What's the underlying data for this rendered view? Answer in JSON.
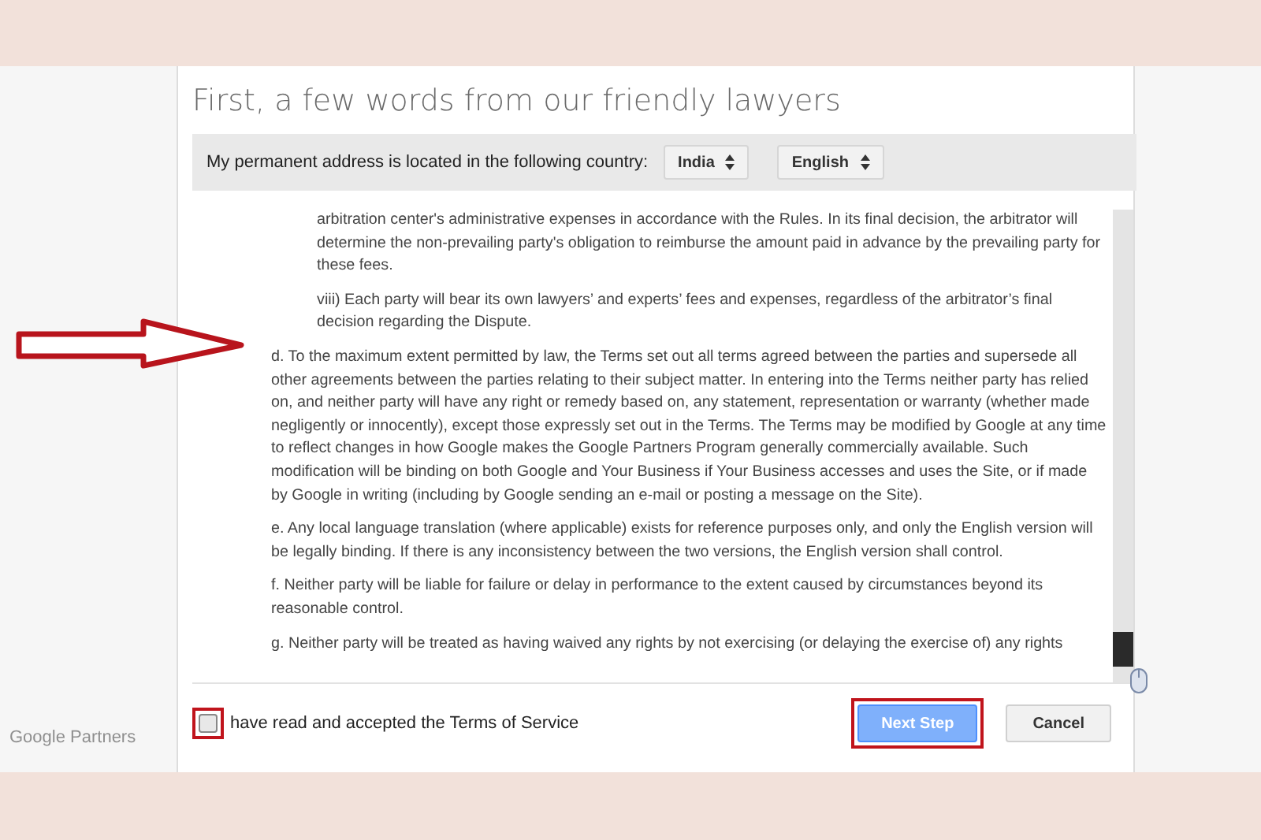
{
  "dialog": {
    "title": "First, a few words from our friendly lawyers",
    "country_bar": {
      "label": "My permanent address is located in the following country:",
      "country": "India",
      "language": "English"
    },
    "terms": [
      {
        "kind": "subitem",
        "text": "arbitration center's administrative expenses in accordance with the Rules. In its final decision, the arbitrator will determine the non-prevailing party's obligation to reimburse the amount paid in advance by the prevailing party for these fees."
      },
      {
        "kind": "subitem",
        "text": "viii) Each party will bear its own lawyers’ and experts’ fees and expenses, regardless of the arbitrator’s final decision regarding the Dispute."
      },
      {
        "kind": "item",
        "text": "d. To the maximum extent permitted by law, the Terms set out all terms agreed between the parties and supersede all other agreements between the parties relating to their subject matter. In entering into the Terms neither party has relied on, and neither party will have any right or remedy based on, any statement, representation or warranty (whether made negligently or innocently), except those expressly set out in the Terms. The Terms may be modified by Google at any time to reflect changes in how Google makes the Google Partners Program generally commercially available. Such modification will be binding on both Google and Your Business if Your Business accesses and uses the Site, or if made by Google in writing (including by Google sending an e-mail or posting a message on the Site)."
      },
      {
        "kind": "item",
        "text": "e. Any local language translation (where applicable) exists for reference purposes only, and only the English version will be legally binding. If there is any inconsistency between the two versions, the English version shall control."
      },
      {
        "kind": "item",
        "text": "f. Neither party will be liable for failure or delay in performance to the extent caused by circumstances beyond its reasonable control."
      },
      {
        "kind": "item",
        "text": "g. Neither party will be treated as having waived any rights by not exercising (or delaying the exercise of) any rights"
      }
    ],
    "accept": {
      "label": "have read and accepted the Terms of Service",
      "checked": false,
      "highlighted": true
    },
    "buttons": [
      {
        "label": "Next Step",
        "kind": "primary",
        "disabled": true,
        "highlighted": true
      },
      {
        "label": "Cancel",
        "kind": "secondary",
        "disabled": false,
        "highlighted": false
      }
    ]
  },
  "footer": {
    "brand": "Google Partners"
  }
}
